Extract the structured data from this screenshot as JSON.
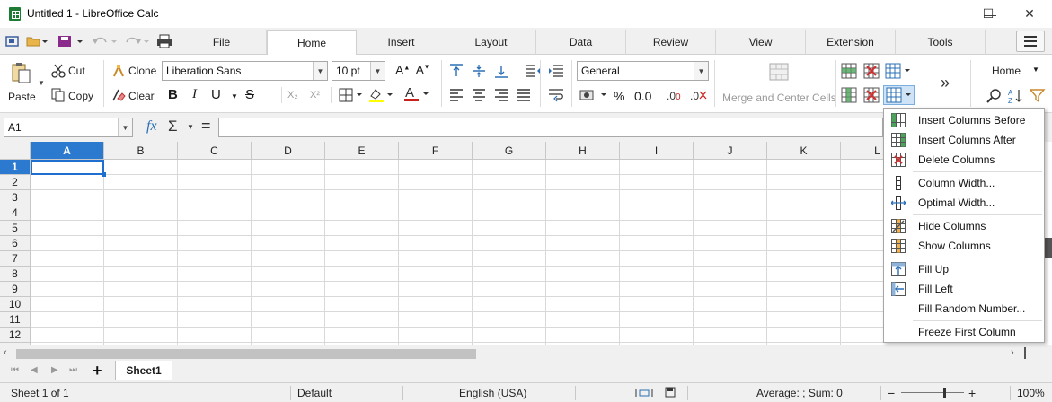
{
  "window": {
    "title": "Untitled 1 - LibreOffice Calc",
    "minimize": "—",
    "maximize": "☐",
    "close": "✕"
  },
  "tabs": [
    "File",
    "Home",
    "Insert",
    "Layout",
    "Data",
    "Review",
    "View",
    "Extension",
    "Tools"
  ],
  "active_tab": "Home",
  "ribbon": {
    "paste": "Paste",
    "cut": "Cut",
    "copy": "Copy",
    "clone": "Clone",
    "clear": "Clear",
    "font_name": "Liberation Sans",
    "font_size": "10 pt",
    "number_format": "General",
    "merge_center": "Merge and Center Cells",
    "home_style": "Home",
    "percent": "%",
    "decimal": "0.0",
    "bold": "B",
    "italic": "I",
    "underline": "U",
    "strike": "S",
    "sub": "X₂",
    "sup": "X²"
  },
  "formula_bar": {
    "name_box": "A1",
    "fx": "fx",
    "sum": "Σ",
    "equals": "=",
    "formula": ""
  },
  "grid": {
    "columns": [
      "A",
      "B",
      "C",
      "D",
      "E",
      "F",
      "G",
      "H",
      "I",
      "J",
      "K",
      "L"
    ],
    "rows": [
      "1",
      "2",
      "3",
      "4",
      "5",
      "6",
      "7",
      "8",
      "9",
      "10",
      "11",
      "12"
    ],
    "selected_cell": "A1"
  },
  "sheets": {
    "tabs": [
      "Sheet1"
    ],
    "active": "Sheet1",
    "add": "+"
  },
  "status": {
    "sheet_info": "Sheet 1 of 1",
    "page_style": "Default",
    "language": "English (USA)",
    "summary": "Average: ; Sum: 0",
    "zoom": "100%",
    "zoom_minus": "−",
    "zoom_plus": "+"
  },
  "menu": {
    "items": [
      {
        "label": "Insert Columns Before",
        "icon": "insert-columns-before-icon"
      },
      {
        "label": "Insert Columns After",
        "icon": "insert-columns-after-icon"
      },
      {
        "label": "Delete Columns",
        "icon": "delete-columns-icon"
      },
      {
        "label": "Column Width...",
        "icon": "column-width-icon"
      },
      {
        "label": "Optimal Width...",
        "icon": "optimal-width-icon"
      },
      {
        "label": "Hide Columns",
        "icon": "hide-columns-icon"
      },
      {
        "label": "Show Columns",
        "icon": "show-columns-icon"
      },
      {
        "label": "Fill Up",
        "icon": "fill-up-icon"
      },
      {
        "label": "Fill Left",
        "icon": "fill-left-icon"
      },
      {
        "label": "Fill Random Number...",
        "icon": ""
      },
      {
        "label": "Freeze First Column",
        "icon": ""
      }
    ]
  },
  "colors": {
    "selection": "#2b7ad0",
    "accent_green": "#1e7b34"
  }
}
